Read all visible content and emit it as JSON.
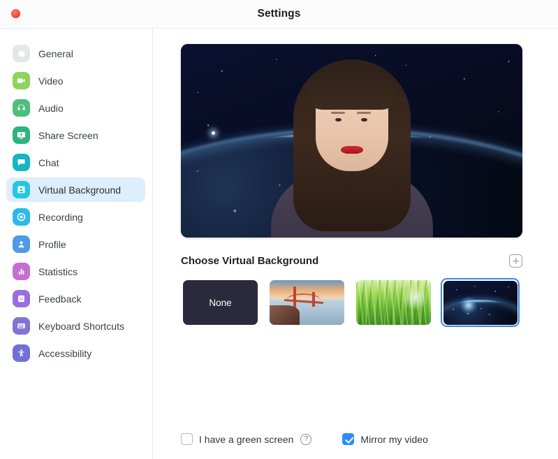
{
  "window": {
    "title": "Settings",
    "close_button": "close"
  },
  "sidebar": {
    "items": [
      {
        "label": "General",
        "icon": "gear-icon",
        "color": "#c9cdd2",
        "active": false
      },
      {
        "label": "Video",
        "icon": "video-camera-icon",
        "color": "#8ed35d",
        "active": false
      },
      {
        "label": "Audio",
        "icon": "headphones-icon",
        "color": "#4cbf7a",
        "active": false
      },
      {
        "label": "Share Screen",
        "icon": "share-screen-icon",
        "color": "#2eb37f",
        "active": false
      },
      {
        "label": "Chat",
        "icon": "chat-bubble-icon",
        "color": "#17b4c4",
        "active": false
      },
      {
        "label": "Virtual Background",
        "icon": "virtual-background-icon",
        "color": "#26c6e0",
        "active": true
      },
      {
        "label": "Recording",
        "icon": "record-circle-icon",
        "color": "#2bb9e8",
        "active": false
      },
      {
        "label": "Profile",
        "icon": "person-icon",
        "color": "#4e9ae8",
        "active": false
      },
      {
        "label": "Statistics",
        "icon": "bar-chart-icon",
        "color": "#c56fd0",
        "active": false
      },
      {
        "label": "Feedback",
        "icon": "smiley-face-icon",
        "color": "#9a6edb",
        "active": false
      },
      {
        "label": "Keyboard Shortcuts",
        "icon": "keyboard-icon",
        "color": "#8273d6",
        "active": false
      },
      {
        "label": "Accessibility",
        "icon": "accessibility-icon",
        "color": "#6f72d4",
        "active": false
      }
    ],
    "active_index": 5,
    "active_highlight_color": "#ddeefc"
  },
  "main": {
    "preview": {
      "name": "video-preview",
      "background_applied": "Earth from space"
    },
    "section": {
      "title": "Choose Virtual Background",
      "add_button": "add-background-button"
    },
    "backgrounds": [
      {
        "label": "None",
        "kind": "none",
        "selected": false
      },
      {
        "label": "Golden Gate Bridge",
        "kind": "bridge",
        "selected": false
      },
      {
        "label": "Grass",
        "kind": "grass",
        "selected": false
      },
      {
        "label": "Earth from Space",
        "kind": "earth",
        "selected": true
      }
    ],
    "selected_index": 3,
    "selection_color": "#3a86f0",
    "options": {
      "green_screen": {
        "label": "I have a green screen",
        "checked": false,
        "help": "?"
      },
      "mirror_video": {
        "label": "Mirror my video",
        "checked": true
      }
    },
    "checkbox_accent": "#2d8cff"
  }
}
